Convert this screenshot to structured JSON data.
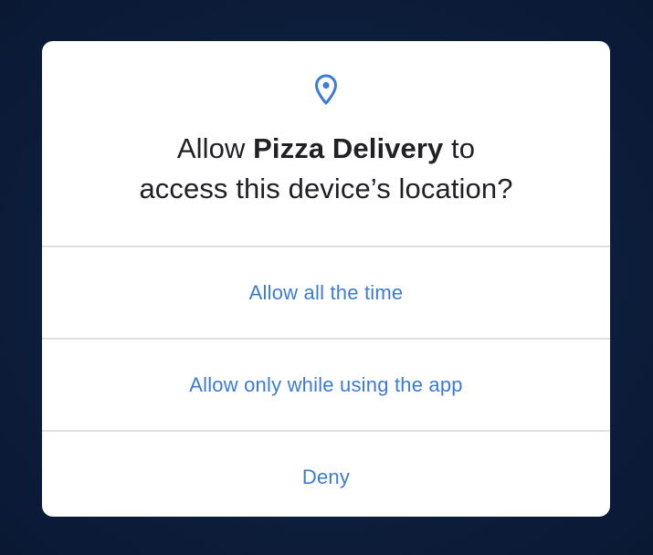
{
  "dialog": {
    "icon": "location-pin-icon",
    "title_prefix": "Allow ",
    "app_name": "Pizza Delivery",
    "title_suffix_line1": " to",
    "title_line2": "access this device’s location?"
  },
  "options": [
    {
      "label": "Allow all the time"
    },
    {
      "label": "Allow only while using the app"
    },
    {
      "label": "Deny"
    }
  ],
  "colors": {
    "accent": "#3c7bd6",
    "background": "#0d1f3c",
    "dialog": "#ffffff",
    "text": "#202124",
    "divider": "#e0e0e0"
  }
}
